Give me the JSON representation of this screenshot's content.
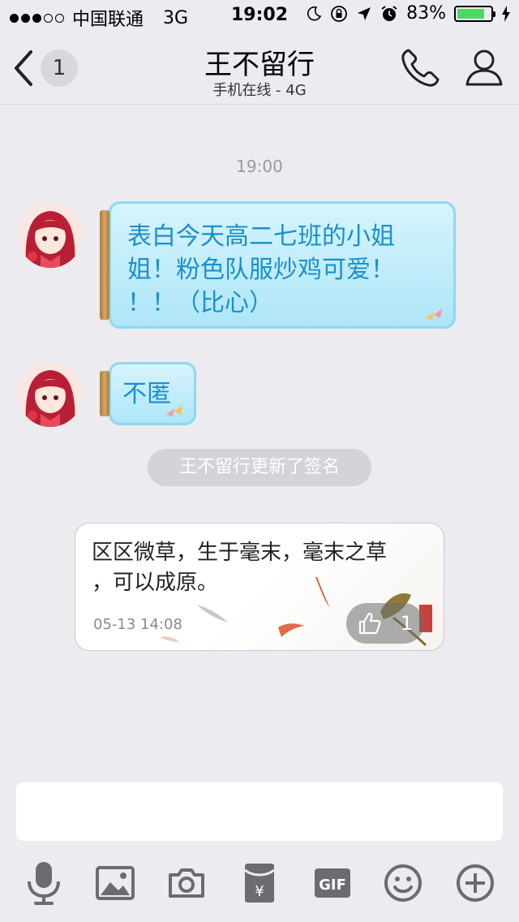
{
  "status_bar": {
    "carrier": "中国联通",
    "network": "3G",
    "time": "19:02",
    "battery": "83%",
    "battery_level": 0.83
  },
  "nav": {
    "unread_count": "1",
    "title": "王不留行",
    "subtitle": "手机在线 - 4G"
  },
  "messages": {
    "timestamp": "19:00",
    "message1": "表白今天高二七班的小姐姐！粉色队服炒鸡可爱！！！（比心）",
    "message1_lines": [
      "表白今天高二七班的小姐",
      "姐！粉色队服炒鸡可爱！",
      "！！（比心）"
    ],
    "message2": "不匿",
    "notice": "王不留行更新了签名",
    "signature_card": {
      "text_lines": [
        "区区微草，生于毫末，毫末之草",
        "，可以成原。"
      ],
      "date": "05-13 14:08",
      "like_count": "1"
    }
  },
  "icons": {
    "back": "back-chevron-icon",
    "phone": "phone-icon",
    "profile": "profile-icon",
    "toolbar": [
      "microphone-icon",
      "image-icon",
      "camera-icon",
      "red-packet-icon",
      "gif-icon",
      "emoji-icon",
      "plus-icon"
    ]
  },
  "colors": {
    "bubble_text": "#1a8fd0",
    "bubble_border": "#8fd8f2",
    "background": "#ebebf0"
  }
}
